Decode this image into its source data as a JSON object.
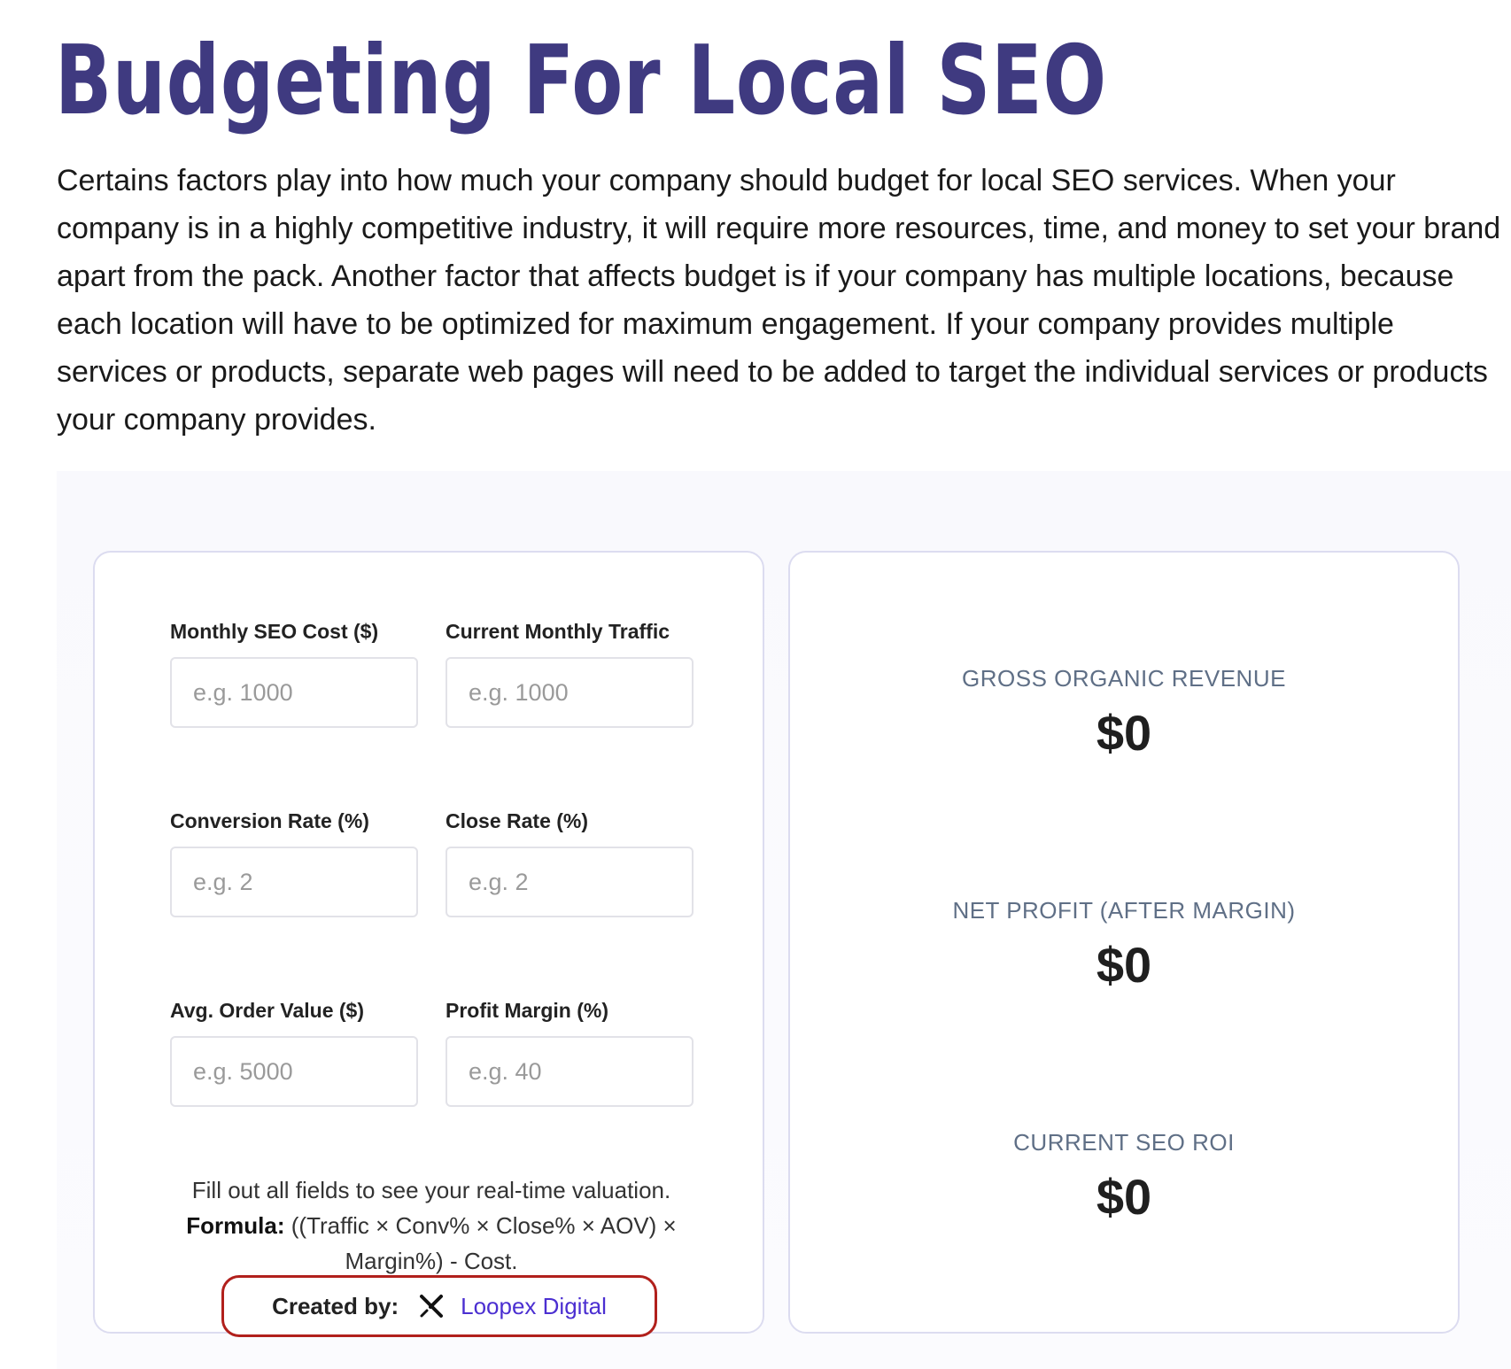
{
  "page": {
    "title": "Budgeting For Local SEO",
    "intro": "Certains factors play into how much your company should budget for local SEO services. When your company is in a highly competitive industry, it will require more resources, time, and money to set your brand apart from the pack. Another factor that affects budget is if your company has multiple locations, because each location will have to be optimized for maximum engagement. If your company provides multiple services or products, separate web pages will need to be added to target the individual services or products your company provides."
  },
  "calculator": {
    "fields": [
      {
        "label": "Monthly SEO Cost ($)",
        "placeholder": "e.g. 1000",
        "value": ""
      },
      {
        "label": "Current Monthly Traffic",
        "placeholder": "e.g. 1000",
        "value": ""
      },
      {
        "label": "Conversion Rate (%)",
        "placeholder": "e.g. 2",
        "value": ""
      },
      {
        "label": "Close Rate (%)",
        "placeholder": "e.g. 2",
        "value": ""
      },
      {
        "label": "Avg. Order Value ($)",
        "placeholder": "e.g. 5000",
        "value": ""
      },
      {
        "label": "Profit Margin (%)",
        "placeholder": "e.g. 40",
        "value": ""
      }
    ],
    "note_text": "Fill out all fields to see your real-time valuation.",
    "formula_label": "Formula:",
    "formula_text": " ((Traffic × Conv% × Close% × AOV) × Margin%) - Cost.",
    "credit_label": "Created by:",
    "credit_link": "Loopex Digital"
  },
  "results": [
    {
      "label": "GROSS ORGANIC REVENUE",
      "value": "$0"
    },
    {
      "label": "NET PROFIT (AFTER MARGIN)",
      "value": "$0"
    },
    {
      "label": "CURRENT SEO ROI",
      "value": "$0"
    }
  ],
  "colors": {
    "title": "#3f3a80",
    "label": "#5f6f86",
    "link": "#4b2fd1",
    "credit_border": "#b1201c",
    "card_border": "#dcdcf0"
  }
}
